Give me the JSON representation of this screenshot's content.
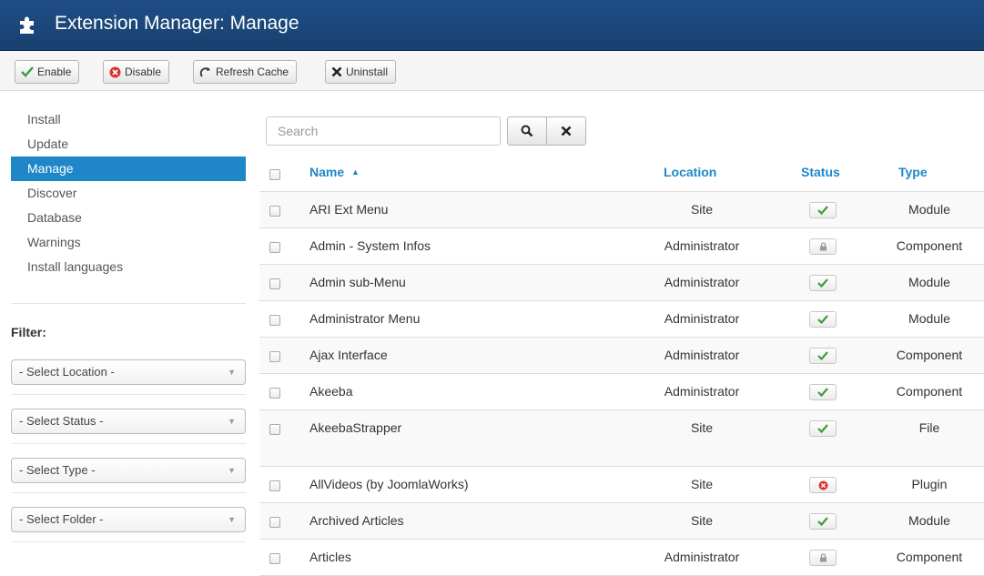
{
  "header": {
    "title": "Extension Manager: Manage",
    "icon": "puzzle-icon"
  },
  "toolbar": {
    "enable_label": "Enable",
    "disable_label": "Disable",
    "refresh_label": "Refresh Cache",
    "uninstall_label": "Uninstall"
  },
  "sidebar": {
    "items": [
      {
        "label": "Install"
      },
      {
        "label": "Update"
      },
      {
        "label": "Manage"
      },
      {
        "label": "Discover"
      },
      {
        "label": "Database"
      },
      {
        "label": "Warnings"
      },
      {
        "label": "Install languages"
      }
    ],
    "active_index": 2
  },
  "filter": {
    "title": "Filter:",
    "location": "- Select Location -",
    "status": "- Select Status -",
    "type": "- Select Type -",
    "folder": "- Select Folder -"
  },
  "search": {
    "placeholder": "Search",
    "value": ""
  },
  "table": {
    "columns": {
      "name": "Name",
      "location": "Location",
      "status": "Status",
      "type": "Type"
    },
    "sort_indicator": "▲",
    "rows": [
      {
        "name": "ARI Ext Menu",
        "location": "Site",
        "status": "enabled",
        "type": "Module"
      },
      {
        "name": "Admin - System Infos",
        "location": "Administrator",
        "status": "locked",
        "type": "Component"
      },
      {
        "name": "Admin sub-Menu",
        "location": "Administrator",
        "status": "enabled",
        "type": "Module"
      },
      {
        "name": "Administrator Menu",
        "location": "Administrator",
        "status": "enabled",
        "type": "Module"
      },
      {
        "name": "Ajax Interface",
        "location": "Administrator",
        "status": "enabled",
        "type": "Component"
      },
      {
        "name": "Akeeba",
        "location": "Administrator",
        "status": "enabled",
        "type": "Component"
      },
      {
        "name": "AkeebaStrapper",
        "location": "Site",
        "status": "enabled",
        "type": "File"
      },
      {
        "name": "AllVideos (by JoomlaWorks)",
        "location": "Site",
        "status": "disabled",
        "type": "Plugin"
      },
      {
        "name": "Archived Articles",
        "location": "Site",
        "status": "enabled",
        "type": "Module"
      },
      {
        "name": "Articles",
        "location": "Administrator",
        "status": "locked",
        "type": "Component"
      }
    ]
  },
  "colors": {
    "accent": "#1f86c8",
    "header": "#1a4677",
    "enabled": "#3c9c3c",
    "disabled": "#d9342b"
  }
}
